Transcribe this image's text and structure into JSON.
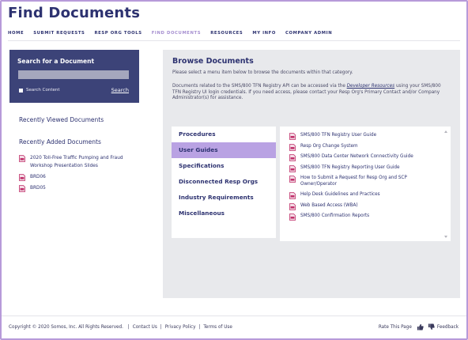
{
  "header": {
    "title": "Find Documents"
  },
  "nav": {
    "items": [
      "HOME",
      "SUBMIT REQUESTS",
      "RESP ORG TOOLS",
      "FIND DOCUMENTS",
      "RESOURCES",
      "MY INFO",
      "COMPANY ADMIN"
    ],
    "active_index": 3
  },
  "search": {
    "title": "Search for a Document",
    "input_value": "",
    "checkbox_label": "Search Content",
    "button_label": "Search"
  },
  "sidebar": {
    "recently_viewed_heading": "Recently Viewed Documents",
    "recently_added_heading": "Recently Added Documents",
    "recently_added": [
      "2020 Toll-Free Traffic Pumping and Fraud Workshop Presentation Slides",
      "BRD06",
      "BRD05"
    ]
  },
  "browse": {
    "title": "Browse Documents",
    "intro": "Please select a menu item below to browse the documents within that category.",
    "api_before": "Documents related to the SMS/800 TFN Registry API can be accessed via the ",
    "api_link": "Developer Resources",
    "api_after": " using your SMS/800 TFN Registry UI login credentials. If you need access, please contact your Resp Org's Primary Contact and/or Company Administrator(s) for assistance.",
    "categories": [
      "Procedures",
      "User Guides",
      "Specifications",
      "Disconnected Resp Orgs",
      "Industry Requirements",
      "Miscellaneous"
    ],
    "active_category_index": 1,
    "documents": [
      "SMS/800 TFN Registry User Guide",
      "Resp Org Change System",
      "SMS/800 Data Center Network Connectivity Guide",
      "SMS/800 TFN Registry Reporting User Guide",
      "How to Submit a Request for Resp Org and SCP Owner/Operator",
      "Help Desk Guidelines and Practices",
      "Web Based Access (WBA)",
      "SMS/800 Confirmation Reports"
    ]
  },
  "footer": {
    "copyright": "Copyright © 2020 Somos, Inc. All Rights Reserved.",
    "links": [
      "Contact Us",
      "Privacy Policy",
      "Terms of Use"
    ],
    "rate_label": "Rate This Page",
    "feedback_label": "Feedback"
  },
  "colors": {
    "brand": "#2d3270",
    "accent": "#b9a2e3",
    "frame": "#b79ad9",
    "search_panel": "#3c4378",
    "pdf_icon": "#c0306a"
  },
  "icons": {
    "document": "pdf-document-icon",
    "thumbs_up": "thumbs-up-icon",
    "thumbs_down": "thumbs-down-icon"
  }
}
